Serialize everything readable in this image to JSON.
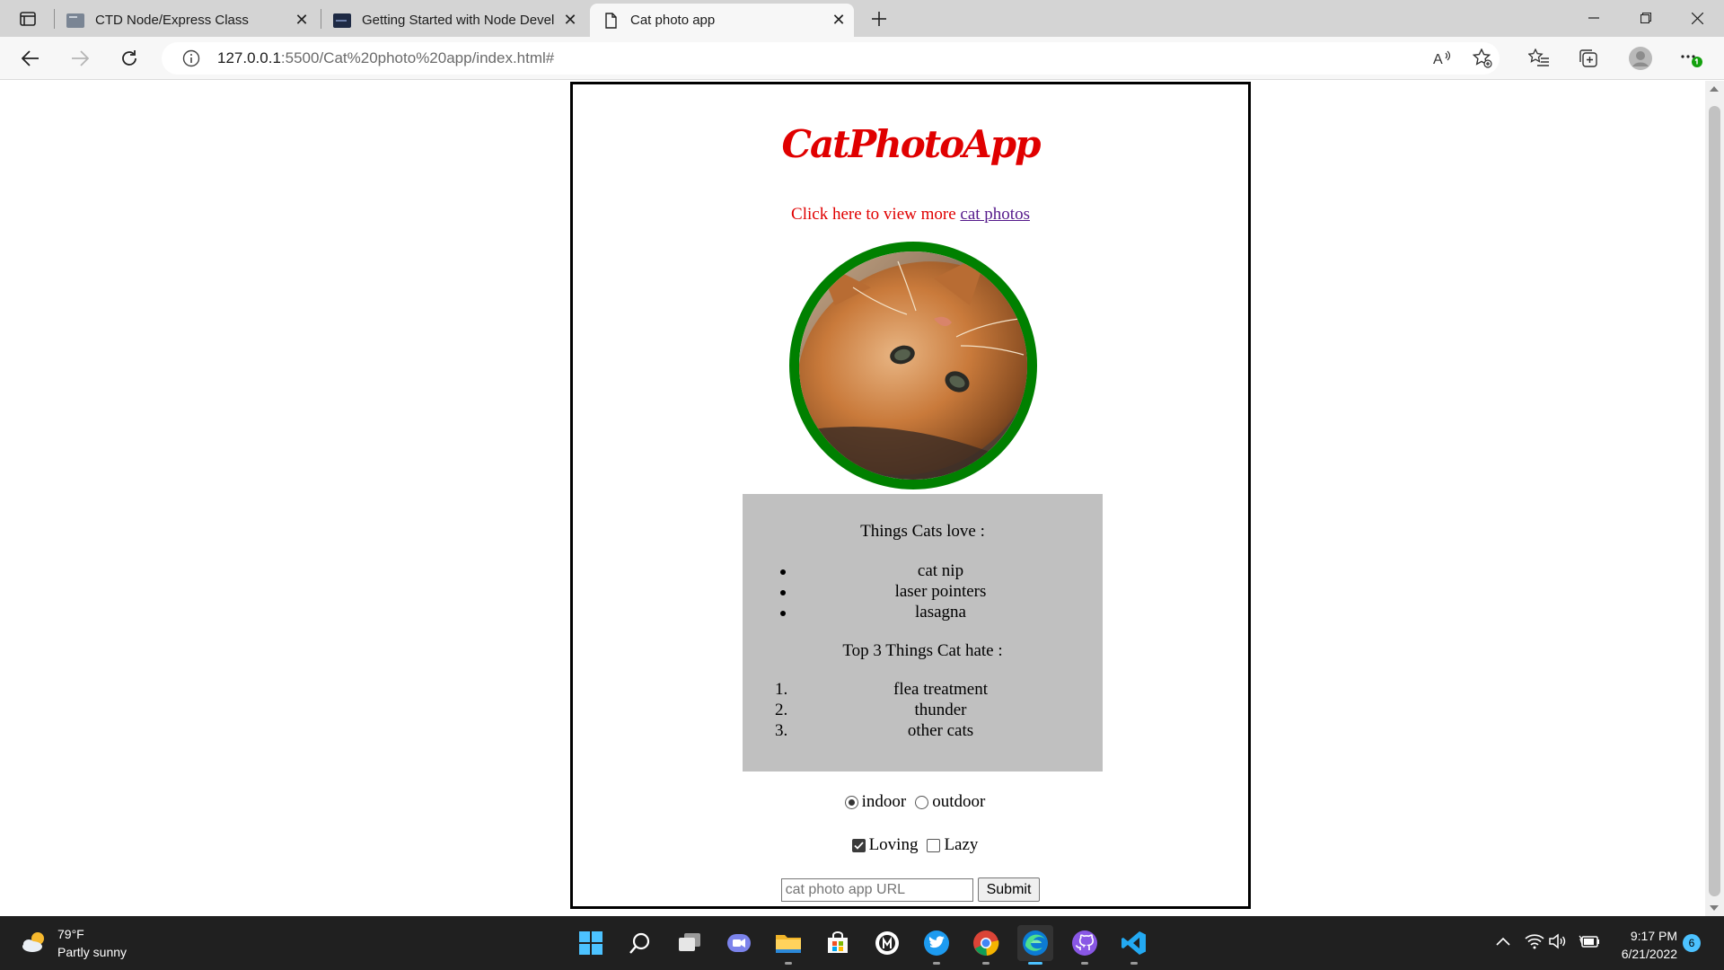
{
  "browser": {
    "tabs": [
      {
        "title": "CTD Node/Express Class",
        "icon": "page-thumbnail-icon",
        "active": false
      },
      {
        "title": "Getting Started with Node Devel",
        "icon": "page-thumbnail-icon",
        "active": false
      },
      {
        "title": "Cat photo app",
        "icon": "document-icon",
        "active": true
      }
    ],
    "address": {
      "host": "127.0.0.1",
      "rest": ":5500/Cat%20photo%20app/index.html#"
    },
    "toolbar_icons": [
      "read-aloud-icon",
      "add-favorite-icon",
      "favorites-icon",
      "collections-icon",
      "profile-icon",
      "more-icon"
    ],
    "accent": "#0078d4"
  },
  "page": {
    "title": "CatPhotoApp",
    "more_prefix": "Click here to view more ",
    "more_link": "cat photos",
    "love_heading": "Things Cats love :",
    "love_items": [
      "cat nip",
      "laser pointers",
      "lasagna"
    ],
    "hate_heading": "Top 3 Things Cat hate :",
    "hate_items": [
      "flea treatment",
      "thunder",
      "other cats"
    ],
    "hate_markers": [
      "1.",
      "2.",
      "3."
    ],
    "radios": [
      {
        "label": "indoor",
        "checked": true
      },
      {
        "label": "outdoor",
        "checked": false
      }
    ],
    "checkboxes": [
      {
        "label": "Loving",
        "checked": true
      },
      {
        "label": "Lazy",
        "checked": false
      }
    ],
    "url_placeholder": "cat photo app URL",
    "submit_label": "Submit",
    "colors": {
      "title": "#e00000",
      "border": "#008000",
      "panel": "#c0c0c0"
    }
  },
  "taskbar": {
    "temperature": "79°F",
    "condition": "Partly sunny",
    "apps": [
      "start-icon",
      "search-icon",
      "task-view-icon",
      "teams-chat-icon",
      "file-explorer-icon",
      "store-icon",
      "app-icon",
      "twitter-icon",
      "chrome-icon",
      "edge-icon",
      "github-desktop-icon",
      "vscode-icon"
    ],
    "time": "9:17 PM",
    "date": "6/21/2022",
    "notifications": "6"
  }
}
